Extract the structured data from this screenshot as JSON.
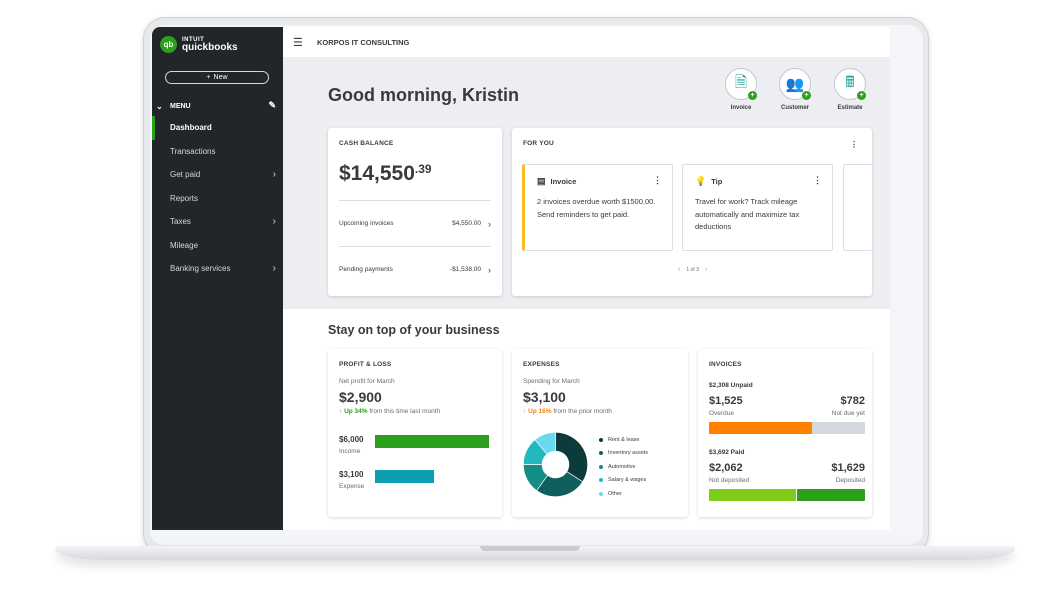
{
  "app": {
    "logo_brand": "INTUIT",
    "logo_product": "quickbooks",
    "logo_mark": "qb",
    "company_name": "KORPOS IT CONSULTING"
  },
  "sidebar": {
    "new_button": "New",
    "menu_label": "MENU",
    "items": [
      {
        "label": "Dashboard",
        "active": true,
        "has_arrow": false
      },
      {
        "label": "Transactions",
        "active": false,
        "has_arrow": false
      },
      {
        "label": "Get paid",
        "active": false,
        "has_arrow": true
      },
      {
        "label": "Reports",
        "active": false,
        "has_arrow": false
      },
      {
        "label": "Taxes",
        "active": false,
        "has_arrow": true
      },
      {
        "label": "Mileage",
        "active": false,
        "has_arrow": false
      },
      {
        "label": "Banking services",
        "active": false,
        "has_arrow": true
      }
    ]
  },
  "header": {
    "greeting": "Good morning, Kristin",
    "quick_actions": [
      {
        "label": "Invoice",
        "icon": "invoice-icon"
      },
      {
        "label": "Customer",
        "icon": "customer-icon"
      },
      {
        "label": "Estimate",
        "icon": "estimate-icon"
      }
    ]
  },
  "cash_balance": {
    "title": "CASH BALANCE",
    "amount_main": "$14,550",
    "amount_cents": ".39",
    "rows": [
      {
        "label": "Upcoming invoices",
        "value": "$4,550.00"
      },
      {
        "label": "Pending payments",
        "value": "-$1,538.00"
      }
    ]
  },
  "for_you": {
    "title": "FOR YOU",
    "cards": [
      {
        "title": "Invoice",
        "text": "2 invoices overdue worth $1500.00. Send reminders to get paid."
      },
      {
        "title": "Tip",
        "text": "Travel for work? Track mileage automatically and maximize tax deductions"
      }
    ],
    "pager": "1 of 3"
  },
  "business": {
    "section_title": "Stay on top of your business",
    "profit_loss": {
      "title": "PROFIT & LOSS",
      "subtitle": "Net profit for March",
      "amount": "$2,900",
      "trend_pct": "Up 34%",
      "trend_text": "from this time last month",
      "income_value": "$6,000",
      "income_label": "Income",
      "expense_value": "$3,100",
      "expense_label": "Expense",
      "income_amount": 6000,
      "expense_amount": 3100,
      "colors": {
        "income": "#2ca01c",
        "expense": "#0d9fb0"
      }
    },
    "expenses": {
      "title": "EXPENSES",
      "subtitle": "Spending for March",
      "amount": "$3,100",
      "trend_pct": "Up 16%",
      "trend_text": "from the prior month",
      "categories": [
        {
          "label": "Rent & lease",
          "share": 0.34,
          "color": "#0b3b3a"
        },
        {
          "label": "Inventory assets",
          "share": 0.26,
          "color": "#0f5f5c"
        },
        {
          "label": "Automotive",
          "share": 0.15,
          "color": "#148d87"
        },
        {
          "label": "Salary & wages",
          "share": 0.14,
          "color": "#21b8c0"
        },
        {
          "label": "Other",
          "share": 0.11,
          "color": "#6ad9ee"
        }
      ]
    },
    "invoices": {
      "title": "INVOICES",
      "unpaid_label": "$2,308 Unpaid",
      "overdue_amount": "$1,525",
      "overdue_label": "Overdue",
      "notdue_amount": "$782",
      "notdue_label": "Not due yet",
      "paid_label": "$3,692 Paid",
      "notdeposited_amount": "$2,062",
      "notdeposited_label": "Not deposited",
      "deposited_amount": "$1,629",
      "deposited_label": "Deposited",
      "overdue_value": 1525,
      "notdue_value": 782,
      "notdeposited_value": 2062,
      "deposited_value": 1629,
      "colors": {
        "overdue": "#ff8000",
        "notdue": "#d4d7dc",
        "notdeposited": "#7fcc18",
        "deposited": "#2ca01c"
      }
    }
  }
}
